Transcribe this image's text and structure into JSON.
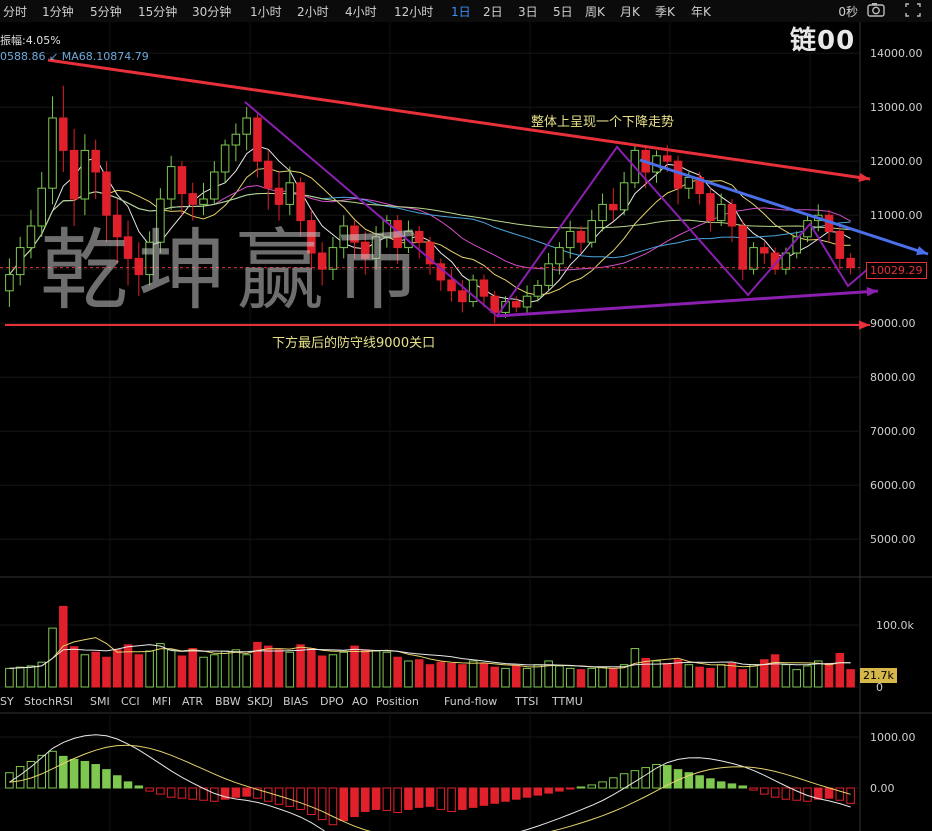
{
  "toolbar": {
    "timeframes": [
      "分时",
      "1分钟",
      "5分钟",
      "15分钟",
      "30分钟",
      "1小时",
      "2小时",
      "4小时",
      "12小时",
      "1日",
      "2日",
      "3日",
      "5日",
      "周K",
      "月K",
      "季K",
      "年K"
    ],
    "active": "1日",
    "countdown": "0秒",
    "icons": [
      "camera-icon",
      "expand-icon"
    ]
  },
  "logo": "链00",
  "watermark": "乾坤赢币",
  "info": {
    "amplitude": "振幅:4.05%",
    "ma_values": "0588.86 ↙ MA68.10874.79"
  },
  "annotations": {
    "top": "整体上呈现一个下降走势",
    "bottom": "下方最后的防守线9000关口"
  },
  "price_badge": "10029.29",
  "volume_badge": "21.7k",
  "indicator_tabs": [
    "SY",
    "StochRSI",
    "SMI",
    "CCI",
    "MFI",
    "ATR",
    "BBW",
    "SKDJ",
    "BIAS",
    "DPO",
    "AO",
    "Position",
    "Fund-flow",
    "TTSI",
    "TTMU"
  ],
  "colors": {
    "up": "#7ec850",
    "down": "#e0202a",
    "trend_red": "#e8303a",
    "trend_blue": "#4a6fe8",
    "purple": "#8a1fb0",
    "active_tab": "#3e8ef7"
  },
  "chart_data": [
    {
      "type": "candlestick",
      "price_axis_ticks": [
        "14000.00",
        "13000.00",
        "12000.00",
        "11000.00",
        "10000.00",
        "9000.00",
        "8000.00",
        "7000.00",
        "6000.00",
        "5000.00"
      ],
      "ylim": [
        4300,
        14300
      ],
      "last_price": 10029.29,
      "candles": [
        [
          9600,
          9900,
          9300,
          10200
        ],
        [
          9900,
          10400,
          9700,
          10600
        ],
        [
          10400,
          10800,
          10200,
          11100
        ],
        [
          10800,
          11500,
          10600,
          11800
        ],
        [
          11500,
          12800,
          11200,
          13200
        ],
        [
          12800,
          12200,
          11800,
          13400
        ],
        [
          12200,
          11300,
          10800,
          12600
        ],
        [
          11300,
          12200,
          11000,
          12500
        ],
        [
          12200,
          11800,
          11300,
          12400
        ],
        [
          11800,
          11000,
          10500,
          12000
        ],
        [
          11000,
          10600,
          10100,
          11300
        ],
        [
          10600,
          10200,
          9700,
          10900
        ],
        [
          10200,
          9900,
          9500,
          10500
        ],
        [
          9900,
          10500,
          9700,
          10700
        ],
        [
          10500,
          11300,
          10300,
          11500
        ],
        [
          11300,
          11900,
          11100,
          12100
        ],
        [
          11900,
          11400,
          11000,
          12000
        ],
        [
          11400,
          11200,
          10900,
          11600
        ],
        [
          11200,
          11300,
          11000,
          11600
        ],
        [
          11300,
          11800,
          11200,
          12000
        ],
        [
          11800,
          12300,
          11600,
          12400
        ],
        [
          12300,
          12500,
          12000,
          12700
        ],
        [
          12500,
          12800,
          12200,
          13000
        ],
        [
          12800,
          12000,
          11700,
          12900
        ],
        [
          12000,
          11500,
          11100,
          12200
        ],
        [
          11500,
          11200,
          10900,
          11800
        ],
        [
          11200,
          11600,
          11000,
          11900
        ],
        [
          11600,
          10900,
          10600,
          11700
        ],
        [
          10900,
          10300,
          10000,
          11100
        ],
        [
          10300,
          10000,
          9700,
          10500
        ],
        [
          10000,
          10400,
          9800,
          10600
        ],
        [
          10400,
          10800,
          10200,
          11000
        ],
        [
          10800,
          10500,
          10200,
          10900
        ],
        [
          10500,
          10200,
          9900,
          10700
        ],
        [
          10200,
          10600,
          10000,
          10800
        ],
        [
          10600,
          10900,
          10400,
          11000
        ],
        [
          10900,
          10400,
          10100,
          11000
        ],
        [
          10400,
          10700,
          10300,
          10900
        ],
        [
          10700,
          10500,
          10200,
          10800
        ],
        [
          10500,
          10100,
          9900,
          10600
        ],
        [
          10100,
          9800,
          9600,
          10200
        ],
        [
          9800,
          9600,
          9400,
          10000
        ],
        [
          9600,
          9400,
          9200,
          9800
        ],
        [
          9400,
          9800,
          9300,
          9900
        ],
        [
          9800,
          9500,
          9300,
          9900
        ],
        [
          9500,
          9200,
          9000,
          9600
        ],
        [
          9200,
          9400,
          9100,
          9500
        ],
        [
          9400,
          9300,
          9200,
          9500
        ],
        [
          9300,
          9500,
          9200,
          9700
        ],
        [
          9500,
          9700,
          9400,
          9800
        ],
        [
          9700,
          10100,
          9600,
          10300
        ],
        [
          10100,
          10400,
          9900,
          10500
        ],
        [
          10400,
          10700,
          10200,
          10900
        ],
        [
          10700,
          10500,
          10300,
          10800
        ],
        [
          10500,
          10900,
          10400,
          11100
        ],
        [
          10900,
          11200,
          10700,
          11400
        ],
        [
          11200,
          11100,
          10900,
          11500
        ],
        [
          11100,
          11600,
          11000,
          11800
        ],
        [
          11600,
          12200,
          11500,
          12300
        ],
        [
          12200,
          11800,
          11500,
          12300
        ],
        [
          11800,
          12100,
          11600,
          12200
        ],
        [
          12100,
          12000,
          11800,
          12300
        ],
        [
          12000,
          11500,
          11200,
          12100
        ],
        [
          11500,
          11700,
          11300,
          11800
        ],
        [
          11700,
          11400,
          11200,
          11800
        ],
        [
          11400,
          10900,
          10700,
          11500
        ],
        [
          10900,
          11200,
          10800,
          11400
        ],
        [
          11200,
          10800,
          10500,
          11300
        ],
        [
          10800,
          10000,
          9800,
          10900
        ],
        [
          10000,
          10400,
          9900,
          10500
        ],
        [
          10400,
          10300,
          10100,
          10500
        ],
        [
          10300,
          10000,
          9900,
          10400
        ],
        [
          10000,
          10300,
          9900,
          10400
        ],
        [
          10300,
          10600,
          10200,
          10700
        ],
        [
          10600,
          10900,
          10500,
          11000
        ],
        [
          10900,
          11000,
          10700,
          11200
        ],
        [
          11000,
          10700,
          10500,
          11100
        ],
        [
          10700,
          10200,
          10000,
          10800
        ],
        [
          10200,
          10029,
          9900,
          10300
        ]
      ],
      "volume_axis_ticks": [
        "100.0k",
        "0"
      ],
      "volume": [
        30,
        32,
        34,
        40,
        95,
        130,
        65,
        52,
        56,
        48,
        60,
        68,
        52,
        58,
        70,
        60,
        50,
        62,
        48,
        52,
        58,
        60,
        52,
        72,
        66,
        60,
        56,
        68,
        62,
        50,
        52,
        56,
        66,
        60,
        58,
        56,
        48,
        42,
        44,
        36,
        40,
        38,
        36,
        42,
        38,
        32,
        30,
        34,
        30,
        36,
        42,
        34,
        30,
        28,
        30,
        32,
        30,
        36,
        62,
        46,
        42,
        38,
        44,
        36,
        32,
        30,
        36,
        38,
        28,
        36,
        44,
        52,
        36,
        28,
        34,
        42,
        38,
        54,
        28
      ],
      "macd_axis_ticks": [
        "1000.00",
        "0.00"
      ],
      "macd_hist": [
        300,
        420,
        520,
        640,
        720,
        620,
        560,
        520,
        460,
        360,
        240,
        120,
        40,
        -60,
        -120,
        -180,
        -200,
        -220,
        -240,
        -260,
        -220,
        -180,
        -160,
        -200,
        -260,
        -320,
        -360,
        -420,
        -520,
        -620,
        -720,
        -640,
        -560,
        -460,
        -420,
        -440,
        -480,
        -420,
        -380,
        -360,
        -420,
        -460,
        -420,
        -380,
        -340,
        -300,
        -260,
        -220,
        -180,
        -140,
        -100,
        -60,
        -20,
        20,
        60,
        120,
        200,
        280,
        340,
        400,
        460,
        440,
        360,
        300,
        240,
        180,
        120,
        80,
        40,
        -40,
        -120,
        -180,
        -220,
        -240,
        -260,
        -220,
        -200,
        -240,
        -300
      ]
    }
  ]
}
